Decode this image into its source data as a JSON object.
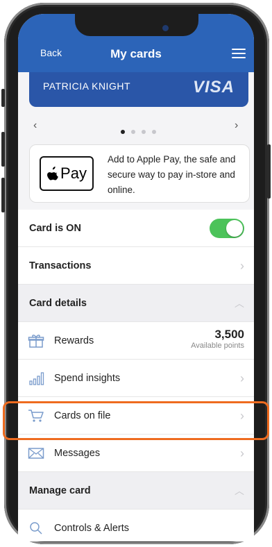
{
  "header": {
    "back_label": "Back",
    "title": "My cards"
  },
  "card": {
    "holder_name": "PATRICIA KNIGHT",
    "network": "VISA",
    "dots_total": 4,
    "active_dot": 1
  },
  "carousel": {
    "prev": "‹",
    "next": "›"
  },
  "apple_pay": {
    "button_text": "Pay",
    "description": "Add to Apple Pay, the safe and secure way to pay in-store and online."
  },
  "rows": {
    "card_on": {
      "label": "Card is ON",
      "enabled": true
    },
    "transactions": {
      "label": "Transactions"
    },
    "card_details": {
      "label": "Card details"
    },
    "rewards": {
      "label": "Rewards",
      "value": "3,500",
      "sublabel": "Available points"
    },
    "spend_insights": {
      "label": "Spend insights"
    },
    "cards_on_file": {
      "label": "Cards on file"
    },
    "messages": {
      "label": "Messages"
    },
    "manage_card": {
      "label": "Manage card"
    },
    "controls": {
      "label": "Controls & Alerts"
    }
  },
  "colors": {
    "header": "#2c64b8",
    "card": "#2a56a8",
    "toggle_on": "#4cc35a",
    "highlight": "#ee6b1f",
    "icon": "#7a9ccc"
  }
}
